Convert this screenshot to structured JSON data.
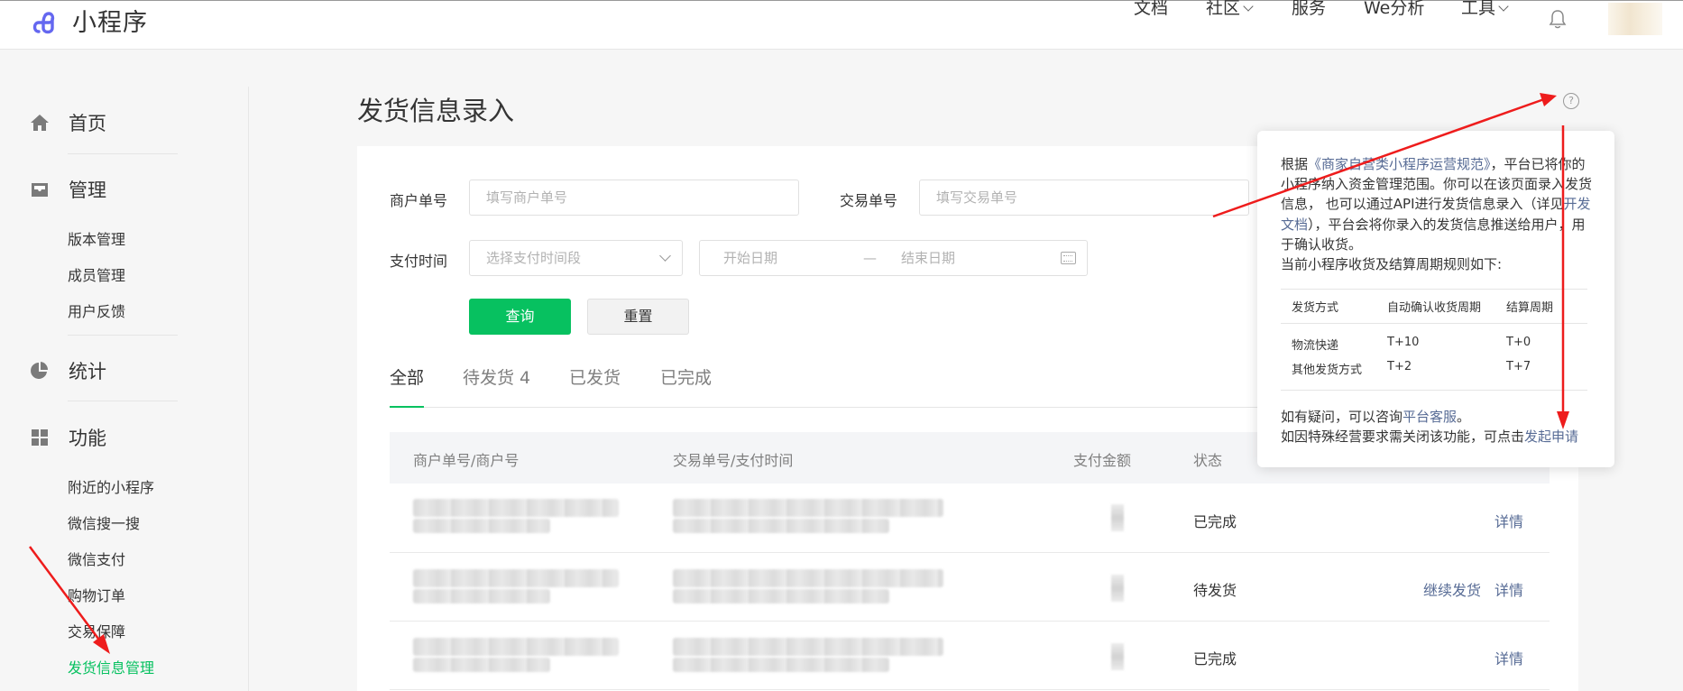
{
  "header": {
    "app_name": "小程序",
    "nav": [
      {
        "label": "文档",
        "has_caret": false
      },
      {
        "label": "社区",
        "has_caret": true
      },
      {
        "label": "服务",
        "has_caret": false
      },
      {
        "label": "We分析",
        "has_caret": false
      },
      {
        "label": "工具",
        "has_caret": true
      }
    ],
    "icons": [
      "bell-icon",
      "avatar"
    ]
  },
  "sidebar": {
    "groups": [
      {
        "label": "首页",
        "icon": "home-icon",
        "items": []
      },
      {
        "label": "管理",
        "icon": "inbox-icon",
        "items": [
          "版本管理",
          "成员管理",
          "用户反馈"
        ]
      },
      {
        "label": "统计",
        "icon": "pie-chart-icon",
        "items": []
      },
      {
        "label": "功能",
        "icon": "grid-icon",
        "items": [
          "附近的小程序",
          "微信搜一搜",
          "微信支付",
          "购物订单",
          "交易保障",
          "发货信息管理"
        ]
      }
    ],
    "active_item": "发货信息管理"
  },
  "page": {
    "title": "发货信息录入",
    "help_icon": "?"
  },
  "filters": {
    "merchant_no_label": "商户单号",
    "merchant_no_placeholder": "填写商户单号",
    "trade_no_label": "交易单号",
    "trade_no_placeholder": "填写交易单号",
    "pay_time_label": "支付时间",
    "pay_time_placeholder": "选择支付时间段",
    "start_date_placeholder": "开始日期",
    "date_separator": "—",
    "end_date_placeholder": "结束日期",
    "query_button": "查询",
    "reset_button": "重置"
  },
  "tabs": [
    {
      "label": "全部",
      "active": true
    },
    {
      "label": "待发货 4",
      "active": false
    },
    {
      "label": "已发货",
      "active": false
    },
    {
      "label": "已完成",
      "active": false
    }
  ],
  "table": {
    "headers": [
      "商户单号/商户号",
      "交易单号/支付时间",
      "支付金额",
      "状态"
    ],
    "rows": [
      {
        "status": "已完成",
        "actions": [
          "详情"
        ]
      },
      {
        "status": "待发货",
        "actions": [
          "继续发货",
          "详情"
        ]
      },
      {
        "status": "已完成",
        "actions": [
          "详情"
        ]
      }
    ]
  },
  "popover": {
    "intro_prefix": "根据",
    "intro_link": "《商家自营类小程序运营规范》",
    "intro_mid": "，平台已将你的小程序纳入资金管理范围。你可以在该页面录入发货信息， 也可以通过API进行发货信息录入（详见",
    "intro_link2": "开发文档",
    "intro_suffix": "），平台会将你录入的发货信息推送给用户，用于确认收货。",
    "rule_line": "当前小程序收货及结算周期规则如下:",
    "table_headers": [
      "发货方式",
      "自动确认收货周期",
      "结算周期"
    ],
    "table_rows": [
      [
        "物流快递",
        "T+10",
        "T+0"
      ],
      [
        "其他发货方式",
        "T+2",
        "T+7"
      ]
    ],
    "footer1_text": "如有疑问，可以咨询",
    "footer1_link": "平台客服",
    "footer1_end": "。",
    "footer2_text": "如因特殊经营要求需关闭该功能，可点击",
    "footer2_link": "发起申请"
  },
  "colors": {
    "accent": "#07c160",
    "link": "#576b95",
    "annotation": "#ee1c1c"
  }
}
